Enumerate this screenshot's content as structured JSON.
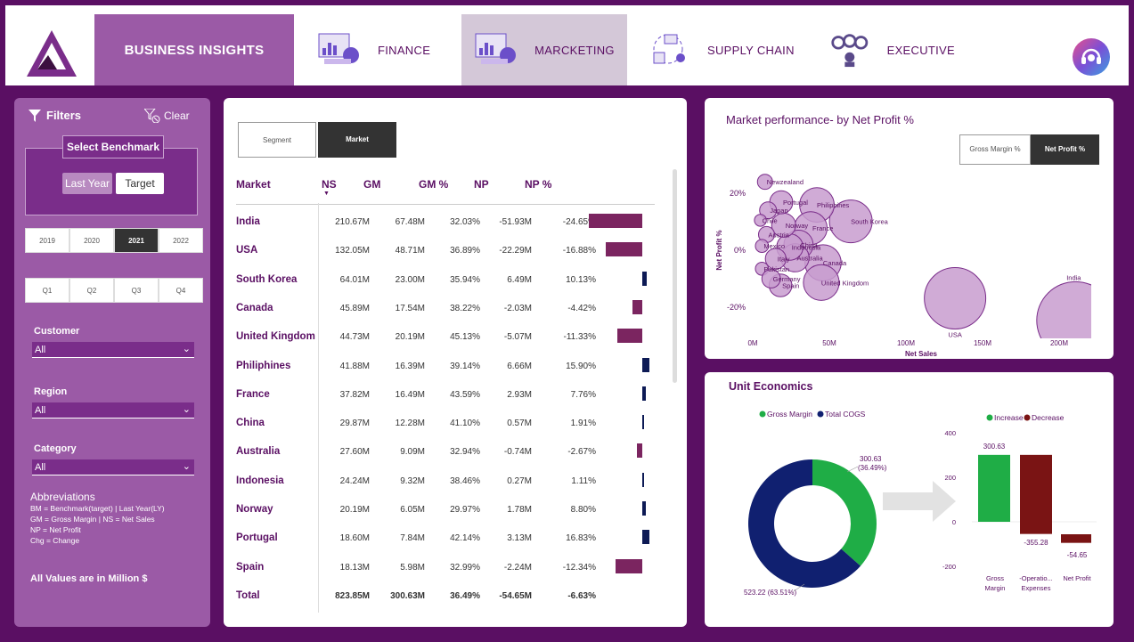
{
  "nav": {
    "business": "BUSINESS INSIGHTS",
    "finance": "FINANCE",
    "marketing": "MARCKETING",
    "supply": "SUPPLY CHAIN",
    "executive": "EXECUTIVE"
  },
  "filters": {
    "title": "Filters",
    "clear": "Clear",
    "benchmark_label": "Select Benchmark",
    "last_year": "Last Year",
    "target": "Target",
    "years": [
      "2019",
      "2020",
      "2021",
      "2022"
    ],
    "selected_year": "2021",
    "quarters": [
      "Q1",
      "Q2",
      "Q3",
      "Q4"
    ],
    "customer_label": "Customer",
    "customer_value": "All",
    "region_label": "Region",
    "region_value": "All",
    "category_label": "Category",
    "category_value": "All",
    "abbr_title": "Abbreviations",
    "abbr_lines": [
      "BM = Benchmark(target) | Last Year(LY)",
      "GM = Gross Margin | NS = Net Sales",
      "NP = Net Profit",
      "Chg = Change"
    ],
    "all_values": "All Values are in Million $"
  },
  "table": {
    "toggle_segment": "Segment",
    "toggle_market": "Market",
    "headers": [
      "Market",
      "NS",
      "GM",
      "GM %",
      "NP",
      "NP %"
    ],
    "rows": [
      {
        "market": "India",
        "ns": "210.67M",
        "gm": "67.48M",
        "gmp": "32.03%",
        "np": "-51.93M",
        "npp": "-24.65%",
        "bar": -24.65
      },
      {
        "market": "USA",
        "ns": "132.05M",
        "gm": "48.71M",
        "gmp": "36.89%",
        "np": "-22.29M",
        "npp": "-16.88%",
        "bar": -16.88
      },
      {
        "market": "South Korea",
        "ns": "64.01M",
        "gm": "23.00M",
        "gmp": "35.94%",
        "np": "6.49M",
        "npp": "10.13%",
        "bar": 10.13
      },
      {
        "market": "Canada",
        "ns": "45.89M",
        "gm": "17.54M",
        "gmp": "38.22%",
        "np": "-2.03M",
        "npp": "-4.42%",
        "bar": -4.42
      },
      {
        "market": "United Kingdom",
        "ns": "44.73M",
        "gm": "20.19M",
        "gmp": "45.13%",
        "np": "-5.07M",
        "npp": "-11.33%",
        "bar": -11.33
      },
      {
        "market": "Philiphines",
        "ns": "41.88M",
        "gm": "16.39M",
        "gmp": "39.14%",
        "np": "6.66M",
        "npp": "15.90%",
        "bar": 15.9
      },
      {
        "market": "France",
        "ns": "37.82M",
        "gm": "16.49M",
        "gmp": "43.59%",
        "np": "2.93M",
        "npp": "7.76%",
        "bar": 7.76
      },
      {
        "market": "China",
        "ns": "29.87M",
        "gm": "12.28M",
        "gmp": "41.10%",
        "np": "0.57M",
        "npp": "1.91%",
        "bar": 1.91
      },
      {
        "market": "Australia",
        "ns": "27.60M",
        "gm": "9.09M",
        "gmp": "32.94%",
        "np": "-0.74M",
        "npp": "-2.67%",
        "bar": -2.67
      },
      {
        "market": "Indonesia",
        "ns": "24.24M",
        "gm": "9.32M",
        "gmp": "38.46%",
        "np": "0.27M",
        "npp": "1.11%",
        "bar": 1.11
      },
      {
        "market": "Norway",
        "ns": "20.19M",
        "gm": "6.05M",
        "gmp": "29.97%",
        "np": "1.78M",
        "npp": "8.80%",
        "bar": 8.8
      },
      {
        "market": "Portugal",
        "ns": "18.60M",
        "gm": "7.84M",
        "gmp": "42.14%",
        "np": "3.13M",
        "npp": "16.83%",
        "bar": 16.83
      },
      {
        "market": "Spain",
        "ns": "18.13M",
        "gm": "5.98M",
        "gmp": "32.99%",
        "np": "-2.24M",
        "npp": "-12.34%",
        "bar": -12.34
      }
    ],
    "total": {
      "market": "Total",
      "ns": "823.85M",
      "gm": "300.63M",
      "gmp": "36.49%",
      "np": "-54.65M",
      "npp": "-6.63%"
    },
    "colors": {
      "negative": "#7b2560",
      "positive": "#0d1a55"
    }
  },
  "scatter": {
    "title": "Market performance- by Net Profit %",
    "toggle_gm": "Gross Margin %",
    "toggle_np": "Net Profit %",
    "xlabel": "Net Sales",
    "ylabel": "Net Profit %",
    "xticks": [
      "0M",
      "50M",
      "100M",
      "150M",
      "200M"
    ],
    "yticks": [
      "20%",
      "0%",
      "-20%"
    ]
  },
  "unit": {
    "title": "Unit Economics",
    "donut_legend": [
      "Gross Margin",
      "Total COGS"
    ],
    "gm_label": "300.63",
    "gm_pct": "(36.49%)",
    "cogs_label": "523.22 (63.51%)",
    "wf_legend": [
      "Increase",
      "Decrease"
    ],
    "wf_yticks": [
      "400",
      "200",
      "0",
      "-200"
    ],
    "wf_values": [
      "300.63",
      "-355.28",
      "-54.65"
    ],
    "wf_cats": [
      "Gross Margin",
      "Operatio... Expenses",
      "Net Profit"
    ],
    "colors": {
      "gm": "#1fad46",
      "cogs": "#102070",
      "decrease": "#7a1414"
    }
  },
  "chart_data": [
    {
      "type": "scatter",
      "title": "Market performance- by Net Profit %",
      "xlabel": "Net Sales",
      "ylabel": "Net Profit %",
      "xlim": [
        0,
        220
      ],
      "ylim": [
        -30,
        30
      ],
      "points": [
        {
          "label": "India",
          "x": 210.67,
          "y": -24.65
        },
        {
          "label": "USA",
          "x": 132.05,
          "y": -16.88
        },
        {
          "label": "South Korea",
          "x": 64.01,
          "y": 10.13
        },
        {
          "label": "Canada",
          "x": 45.89,
          "y": -4.42
        },
        {
          "label": "United Kingdom",
          "x": 44.73,
          "y": -11.33
        },
        {
          "label": "Philiphines",
          "x": 41.88,
          "y": 15.9
        },
        {
          "label": "France",
          "x": 37.82,
          "y": 7.76
        },
        {
          "label": "China",
          "x": 29.87,
          "y": 1.91
        },
        {
          "label": "Australia",
          "x": 27.6,
          "y": -2.67
        },
        {
          "label": "Indonesia",
          "x": 24.24,
          "y": 1.11
        },
        {
          "label": "Norway",
          "x": 20.19,
          "y": 8.8
        },
        {
          "label": "Portugal",
          "x": 18.6,
          "y": 16.83
        },
        {
          "label": "Spain",
          "x": 18.13,
          "y": -12.34
        },
        {
          "label": "Newzealand",
          "x": 8.0,
          "y": 24.0
        },
        {
          "label": "Japan",
          "x": 10.0,
          "y": 14.0
        },
        {
          "label": "Chile",
          "x": 5.0,
          "y": 10.5
        },
        {
          "label": "Austria",
          "x": 9.0,
          "y": 5.5
        },
        {
          "label": "Mexico",
          "x": 6.0,
          "y": 1.5
        },
        {
          "label": "Italy",
          "x": 15.0,
          "y": -3.0
        },
        {
          "label": "Pakistan",
          "x": 6.0,
          "y": -6.5
        },
        {
          "label": "Germany",
          "x": 12.0,
          "y": -10.0
        }
      ]
    },
    {
      "type": "pie",
      "series": [
        {
          "name": "Gross Margin",
          "value": 300.63
        },
        {
          "name": "Total COGS",
          "value": 523.22
        }
      ]
    },
    {
      "type": "bar",
      "categories": [
        "Gross Margin",
        "Operatio... Expenses",
        "Net Profit"
      ],
      "values": [
        300.63,
        -355.28,
        -54.65
      ],
      "ylim": [
        -200,
        400
      ]
    }
  ]
}
